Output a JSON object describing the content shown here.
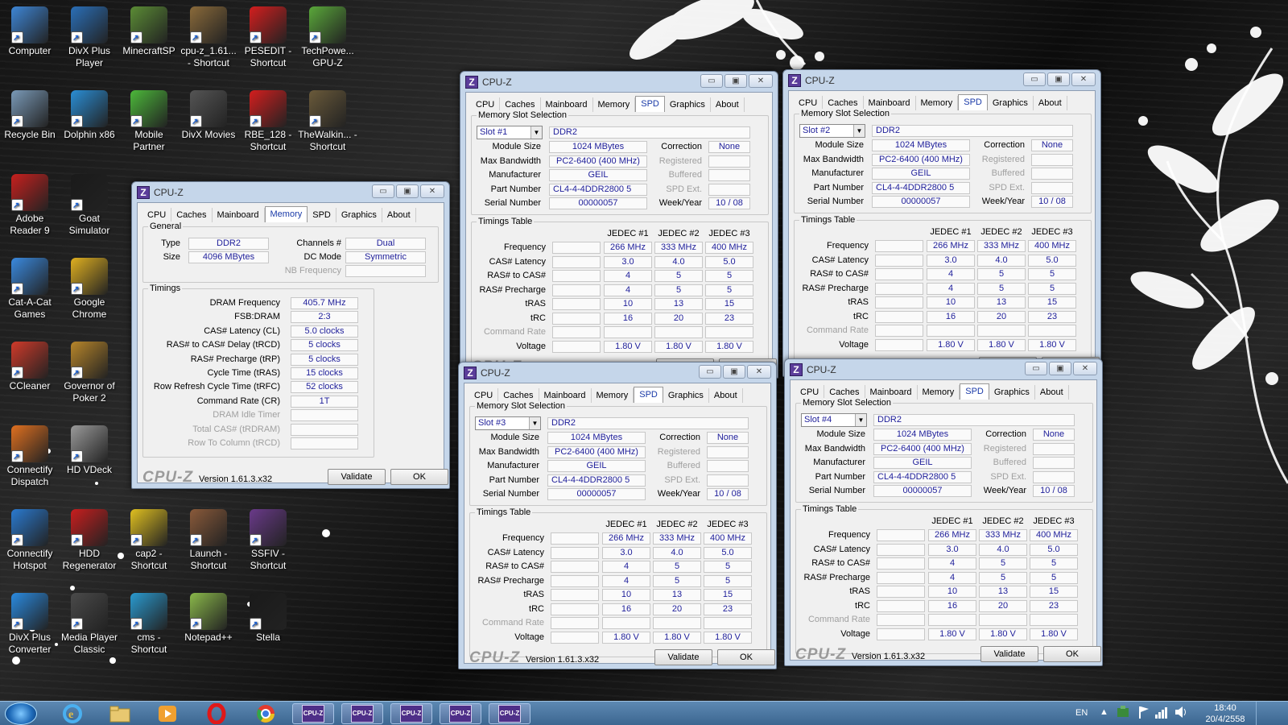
{
  "desktop_icons": [
    {
      "label": "Computer",
      "icon": "computer-icon",
      "color": "#3e86d6"
    },
    {
      "label": "DivX Plus Player",
      "icon": "divx-player-icon",
      "color": "#2a6fb8"
    },
    {
      "label": "MinecraftSP",
      "icon": "minecraft-icon",
      "color": "#5b8c35"
    },
    {
      "label": "cpu-z_1.61... - Shortcut",
      "icon": "cpuz-folder-icon",
      "color": "#8a6a3a"
    },
    {
      "label": "PESEDIT - Shortcut",
      "icon": "pesedit-icon",
      "color": "#d41e1e"
    },
    {
      "label": "TechPowe... GPU-Z",
      "icon": "gpuz-icon",
      "color": "#5aa83a"
    },
    {
      "label": "Recycle Bin",
      "icon": "recycle-bin-icon",
      "color": "#7a9ab8"
    },
    {
      "label": "Dolphin x86",
      "icon": "dolphin-icon",
      "color": "#2a8ed6"
    },
    {
      "label": "Mobile Partner",
      "icon": "mobile-partner-icon",
      "color": "#4cb83a"
    },
    {
      "label": "DivX Movies",
      "icon": "divx-movies-icon",
      "color": "#555555"
    },
    {
      "label": "RBE_128 - Shortcut",
      "icon": "ati-icon",
      "color": "#d41e1e"
    },
    {
      "label": "TheWalkin... - Shortcut",
      "icon": "walking-dead-icon",
      "color": "#6a5a3a"
    },
    {
      "label": "Adobe Reader 9",
      "icon": "adobe-reader-icon",
      "color": "#c8201e"
    },
    {
      "label": "Goat Simulator",
      "icon": "goat-simulator-icon",
      "color": "#1a1a1a"
    },
    {
      "label": "Cat-A-Cat Games",
      "icon": "cat-a-cat-icon",
      "color": "#3a8ae0"
    },
    {
      "label": "Google Chrome",
      "icon": "chrome-icon",
      "color": "#e0b020"
    },
    {
      "label": "CCleaner",
      "icon": "ccleaner-icon",
      "color": "#d03a2a"
    },
    {
      "label": "Governor of Poker 2",
      "icon": "poker-icon",
      "color": "#b8862a"
    },
    {
      "label": "Connectify Dispatch",
      "icon": "connectify-dispatch-icon",
      "color": "#e07020"
    },
    {
      "label": "HD VDeck",
      "icon": "hd-vdeck-icon",
      "color": "#9a9a9a"
    },
    {
      "label": "Connectify Hotspot",
      "icon": "connectify-hotspot-icon",
      "color": "#2a7ad0"
    },
    {
      "label": "HDD Regenerator",
      "icon": "hdd-regenerator-icon",
      "color": "#c81e1e"
    },
    {
      "label": "cap2 - Shortcut",
      "icon": "cap2-icon",
      "color": "#e0c020"
    },
    {
      "label": "Launch - Shortcut",
      "icon": "launch-icon",
      "color": "#8a5a3a"
    },
    {
      "label": "SSFIV - Shortcut",
      "icon": "ssfiv-icon",
      "color": "#6a3a8a"
    },
    {
      "label": "DivX Plus Converter",
      "icon": "divx-converter-icon",
      "color": "#2a8ae0"
    },
    {
      "label": "Media Player Classic",
      "icon": "media-player-classic-icon",
      "color": "#4a4a4a"
    },
    {
      "label": "cms - Shortcut",
      "icon": "cms-icon",
      "color": "#2a9ad0"
    },
    {
      "label": "Notepad++",
      "icon": "notepadpp-icon",
      "color": "#8ab84a"
    },
    {
      "label": "Stella",
      "icon": "stella-icon",
      "color": "#1a1a1a"
    }
  ],
  "common": {
    "app_title": "CPU-Z",
    "minimize": "▭",
    "restore": "▣",
    "close": "✕",
    "tabs": [
      "CPU",
      "Caches",
      "Mainboard",
      "Memory",
      "SPD",
      "Graphics",
      "About"
    ],
    "logo": "CPU-Z",
    "version": "Version 1.61.3.x32",
    "validate": "Validate",
    "ok": "OK"
  },
  "memory_window": {
    "group_general": "General",
    "type_label": "Type",
    "type": "DDR2",
    "size_label": "Size",
    "size": "4096 MBytes",
    "channels_label": "Channels #",
    "channels": "Dual",
    "dcmode_label": "DC Mode",
    "dcmode": "Symmetric",
    "nbfreq_label": "NB Frequency",
    "nbfreq": "",
    "group_timings": "Timings",
    "timings": [
      {
        "label": "DRAM Frequency",
        "value": "405.7 MHz",
        "dim": false
      },
      {
        "label": "FSB:DRAM",
        "value": "2:3",
        "dim": false
      },
      {
        "label": "CAS# Latency (CL)",
        "value": "5.0 clocks",
        "dim": false
      },
      {
        "label": "RAS# to CAS# Delay (tRCD)",
        "value": "5 clocks",
        "dim": false
      },
      {
        "label": "RAS# Precharge (tRP)",
        "value": "5 clocks",
        "dim": false
      },
      {
        "label": "Cycle Time (tRAS)",
        "value": "15 clocks",
        "dim": false
      },
      {
        "label": "Row Refresh Cycle Time (tRFC)",
        "value": "52 clocks",
        "dim": false
      },
      {
        "label": "Command Rate (CR)",
        "value": "1T",
        "dim": false
      },
      {
        "label": "DRAM Idle Timer",
        "value": "",
        "dim": true
      },
      {
        "label": "Total CAS# (tRDRAM)",
        "value": "",
        "dim": true
      },
      {
        "label": "Row To Column (tRCD)",
        "value": "",
        "dim": true
      }
    ]
  },
  "spd_labels": {
    "group_slot": "Memory Slot Selection",
    "module_size": "Module Size",
    "max_bw": "Max Bandwidth",
    "manufacturer": "Manufacturer",
    "part_number": "Part Number",
    "serial_number": "Serial Number",
    "correction": "Correction",
    "registered": "Registered",
    "buffered": "Buffered",
    "spd_ext": "SPD Ext.",
    "week_year": "Week/Year",
    "group_timings": "Timings Table",
    "jedec": [
      "JEDEC #1",
      "JEDEC #2",
      "JEDEC #3"
    ],
    "rows": [
      "Frequency",
      "CAS# Latency",
      "RAS# to CAS#",
      "RAS# Precharge",
      "tRAS",
      "tRC",
      "Command Rate",
      "Voltage"
    ]
  },
  "spd_windows": [
    {
      "slot": "Slot #1",
      "type": "DDR2",
      "module_size": "1024 MBytes",
      "max_bw": "PC2-6400 (400 MHz)",
      "manufacturer": "GEIL",
      "part_number": "CL4-4-4DDR2800  5",
      "serial_number": "00000057",
      "correction": "None",
      "week_year": "10 / 08",
      "timings": [
        [
          "266 MHz",
          "333 MHz",
          "400 MHz"
        ],
        [
          "3.0",
          "4.0",
          "5.0"
        ],
        [
          "4",
          "5",
          "5"
        ],
        [
          "4",
          "5",
          "5"
        ],
        [
          "10",
          "13",
          "15"
        ],
        [
          "16",
          "20",
          "23"
        ],
        [
          "",
          "",
          ""
        ],
        [
          "1.80 V",
          "1.80 V",
          "1.80 V"
        ]
      ]
    },
    {
      "slot": "Slot #2",
      "type": "DDR2",
      "module_size": "1024 MBytes",
      "max_bw": "PC2-6400 (400 MHz)",
      "manufacturer": "GEIL",
      "part_number": "CL4-4-4DDR2800  5",
      "serial_number": "00000057",
      "correction": "None",
      "week_year": "10 / 08",
      "timings": [
        [
          "266 MHz",
          "333 MHz",
          "400 MHz"
        ],
        [
          "3.0",
          "4.0",
          "5.0"
        ],
        [
          "4",
          "5",
          "5"
        ],
        [
          "4",
          "5",
          "5"
        ],
        [
          "10",
          "13",
          "15"
        ],
        [
          "16",
          "20",
          "23"
        ],
        [
          "",
          "",
          ""
        ],
        [
          "1.80 V",
          "1.80 V",
          "1.80 V"
        ]
      ]
    },
    {
      "slot": "Slot #3",
      "type": "DDR2",
      "module_size": "1024 MBytes",
      "max_bw": "PC2-6400 (400 MHz)",
      "manufacturer": "GEIL",
      "part_number": "CL4-4-4DDR2800  5",
      "serial_number": "00000057",
      "correction": "None",
      "week_year": "10 / 08",
      "timings": [
        [
          "266 MHz",
          "333 MHz",
          "400 MHz"
        ],
        [
          "3.0",
          "4.0",
          "5.0"
        ],
        [
          "4",
          "5",
          "5"
        ],
        [
          "4",
          "5",
          "5"
        ],
        [
          "10",
          "13",
          "15"
        ],
        [
          "16",
          "20",
          "23"
        ],
        [
          "",
          "",
          ""
        ],
        [
          "1.80 V",
          "1.80 V",
          "1.80 V"
        ]
      ]
    },
    {
      "slot": "Slot #4",
      "type": "DDR2",
      "module_size": "1024 MBytes",
      "max_bw": "PC2-6400 (400 MHz)",
      "manufacturer": "GEIL",
      "part_number": "CL4-4-4DDR2800  5",
      "serial_number": "00000057",
      "correction": "None",
      "week_year": "10 / 08",
      "timings": [
        [
          "266 MHz",
          "333 MHz",
          "400 MHz"
        ],
        [
          "3.0",
          "4.0",
          "5.0"
        ],
        [
          "4",
          "5",
          "5"
        ],
        [
          "4",
          "5",
          "5"
        ],
        [
          "10",
          "13",
          "15"
        ],
        [
          "16",
          "20",
          "23"
        ],
        [
          "",
          "",
          ""
        ],
        [
          "1.80 V",
          "1.80 V",
          "1.80 V"
        ]
      ]
    }
  ],
  "taskbar": {
    "pinned": [
      "ie-icon",
      "explorer-icon",
      "media-player-icon",
      "opera-icon",
      "chrome-icon"
    ],
    "cpuz_buttons": [
      "CPU-Z",
      "CPU-Z",
      "CPU-Z",
      "CPU-Z",
      "CPU-Z"
    ],
    "lang": "EN",
    "time": "18:40",
    "date": "20/4/2558"
  }
}
